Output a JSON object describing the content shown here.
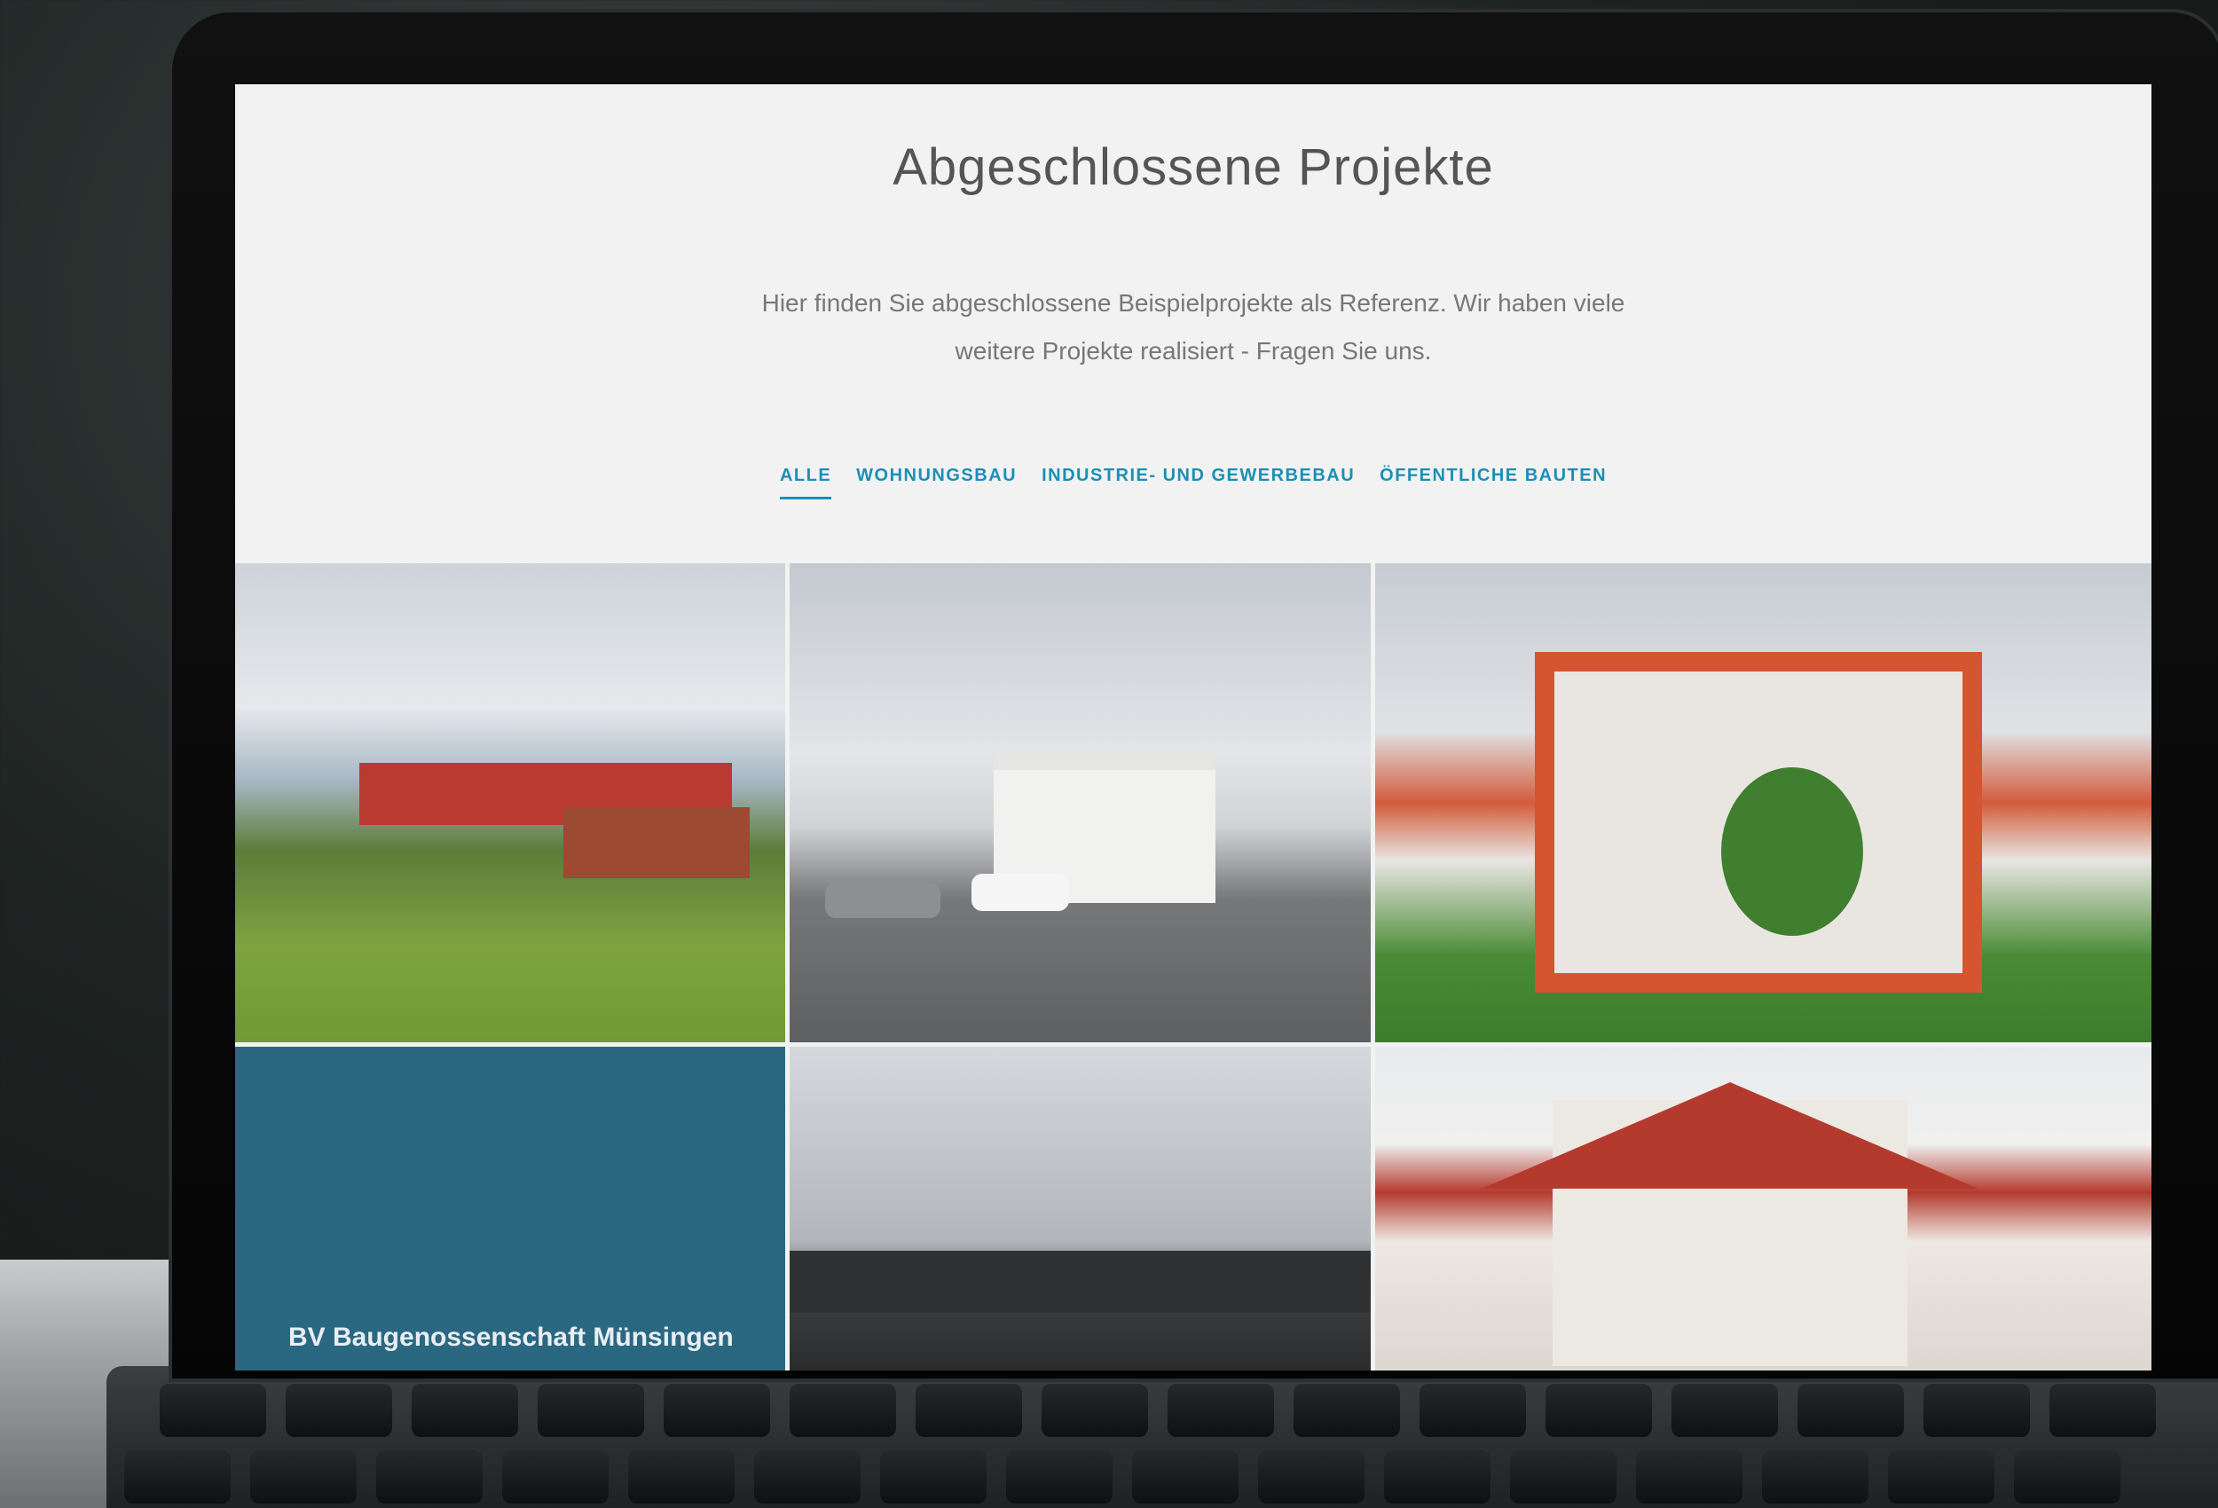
{
  "page": {
    "title": "Abgeschlossene Projekte",
    "intro": "Hier finden Sie abgeschlossene Beispielprojekte als Referenz. Wir haben viele weitere Projekte realisiert - Fragen Sie uns."
  },
  "filters": [
    {
      "label": "ALLE",
      "active": true
    },
    {
      "label": "WOHNUNGSBAU",
      "active": false
    },
    {
      "label": "INDUSTRIE- UND GEWERBEBAU",
      "active": false
    },
    {
      "label": "ÖFFENTLICHE BAUTEN",
      "active": false
    }
  ],
  "projects": [
    {
      "caption": ""
    },
    {
      "caption": ""
    },
    {
      "caption": ""
    },
    {
      "caption": "BV Baugenossenschaft Münsingen"
    },
    {
      "caption": ""
    },
    {
      "caption": ""
    }
  ],
  "colors": {
    "accent": "#1b8fb5",
    "overlay": "#2a6882"
  }
}
